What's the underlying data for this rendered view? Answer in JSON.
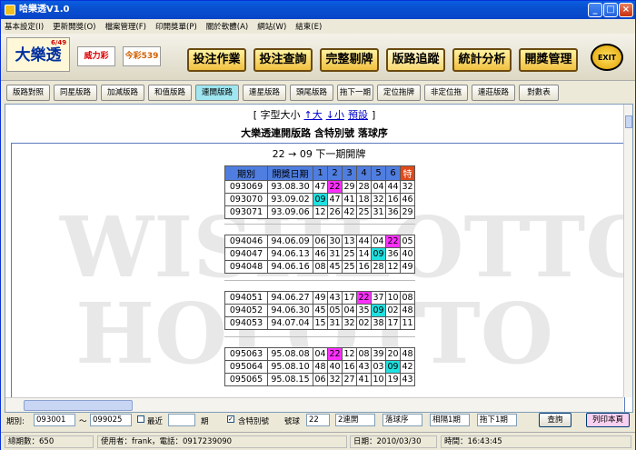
{
  "window": {
    "title": "哈樂透V1.0"
  },
  "menu": [
    "基本設定(I)",
    "更新開獎(O)",
    "檔案管理(F)",
    "印開獎單(P)",
    "關於軟體(A)",
    "網站(W)",
    "結束(E)"
  ],
  "logos": {
    "lotto": "大樂透",
    "lotto_sup": "6/49",
    "power": "威力彩",
    "daily": "今彩539"
  },
  "big_buttons": [
    "投注作業",
    "投注查詢",
    "完整剔牌",
    "版路追蹤",
    "統計分析",
    "開獎管理"
  ],
  "exit_label": "EXIT",
  "tabs": [
    "版路對照",
    "同星版路",
    "加減版路",
    "和值版路",
    "連開版路",
    "連星版路",
    "頭尾版路",
    "拖下一期",
    "定位拖牌",
    "非定位拖",
    "連莊版路",
    "對數表"
  ],
  "font_ctl": {
    "open": "[ 字型大小",
    "bigger": "↑大",
    "smaller": "↓小",
    "default": "預設",
    "close": "]"
  },
  "doc_title": "大樂透連開版路 含特別號 落球序",
  "subtitle": "22 → 09 下一期開牌",
  "headers": {
    "period": "期別",
    "date": "開獎日期",
    "n1": "1",
    "n2": "2",
    "n3": "3",
    "n4": "4",
    "n5": "5",
    "n6": "6",
    "sp": "特"
  },
  "groups": [
    {
      "rows": [
        {
          "id": "093069",
          "date": "93.08.30",
          "nums": [
            "47",
            "22",
            "29",
            "28",
            "04",
            "44",
            "32"
          ]
        },
        {
          "id": "093070",
          "date": "93.09.02",
          "nums": [
            "09",
            "47",
            "41",
            "18",
            "32",
            "16",
            "46"
          ]
        },
        {
          "id": "093071",
          "date": "93.09.06",
          "nums": [
            "12",
            "26",
            "42",
            "25",
            "31",
            "36",
            "29"
          ]
        }
      ]
    },
    {
      "rows": [
        {
          "id": "094046",
          "date": "94.06.09",
          "nums": [
            "06",
            "30",
            "13",
            "44",
            "04",
            "22",
            "05"
          ]
        },
        {
          "id": "094047",
          "date": "94.06.13",
          "nums": [
            "46",
            "31",
            "25",
            "14",
            "09",
            "36",
            "40"
          ]
        },
        {
          "id": "094048",
          "date": "94.06.16",
          "nums": [
            "08",
            "45",
            "25",
            "16",
            "28",
            "12",
            "49"
          ]
        }
      ]
    },
    {
      "rows": [
        {
          "id": "094051",
          "date": "94.06.27",
          "nums": [
            "49",
            "43",
            "17",
            "22",
            "37",
            "10",
            "08"
          ]
        },
        {
          "id": "094052",
          "date": "94.06.30",
          "nums": [
            "45",
            "05",
            "04",
            "35",
            "09",
            "02",
            "48"
          ]
        },
        {
          "id": "094053",
          "date": "94.07.04",
          "nums": [
            "15",
            "31",
            "32",
            "02",
            "38",
            "17",
            "11"
          ]
        }
      ]
    },
    {
      "rows": [
        {
          "id": "095063",
          "date": "95.08.08",
          "nums": [
            "04",
            "22",
            "12",
            "08",
            "39",
            "20",
            "48"
          ]
        },
        {
          "id": "095064",
          "date": "95.08.10",
          "nums": [
            "48",
            "40",
            "16",
            "43",
            "03",
            "09",
            "42"
          ]
        },
        {
          "id": "095065",
          "date": "95.08.15",
          "nums": [
            "06",
            "32",
            "27",
            "41",
            "10",
            "19",
            "43"
          ]
        }
      ]
    }
  ],
  "controls": {
    "period_label": "期別:",
    "from": "093001",
    "tilde": "～",
    "to": "099025",
    "recent_label": "最近",
    "recent_val": "",
    "period_unit": "期",
    "include_sp": "含特別號",
    "ball_label": "號球",
    "ball": "22",
    "mode": "2連開",
    "order": "落球序",
    "span": "相隔1期",
    "drag": "拖下1期",
    "query": "查詢",
    "print": "列印本頁"
  },
  "status": {
    "total": "總期數：650",
    "user": "使用者：frank，電話：0917239090",
    "date": "日期：2010/03/30",
    "time": "時間：16:43:45"
  }
}
